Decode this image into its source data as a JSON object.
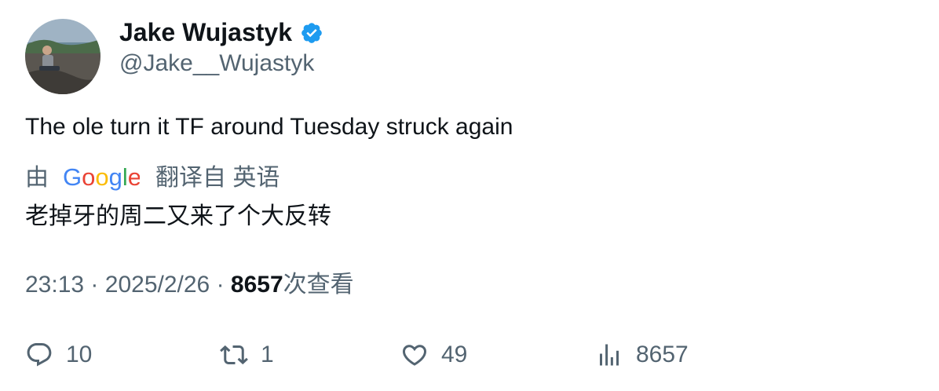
{
  "tweet": {
    "display_name": "Jake Wujastyk",
    "handle": "@Jake__Wujastyk",
    "verified": true,
    "text": "The ole turn it TF around Tuesday struck again"
  },
  "translation": {
    "prefix": "由",
    "provider": "Google",
    "suffix": "翻译自 英语",
    "text": "老掉牙的周二又来了个大反转"
  },
  "meta": {
    "time": "23:13",
    "date": "2025/2/26",
    "separator": "·",
    "views_count": "8657",
    "views_label": "次查看"
  },
  "actions": {
    "reply_count": "10",
    "retweet_count": "1",
    "like_count": "49",
    "views_count": "8657"
  },
  "colors": {
    "text_primary": "#0f1419",
    "text_secondary": "#536471",
    "verified_blue": "#1d9bf0"
  }
}
